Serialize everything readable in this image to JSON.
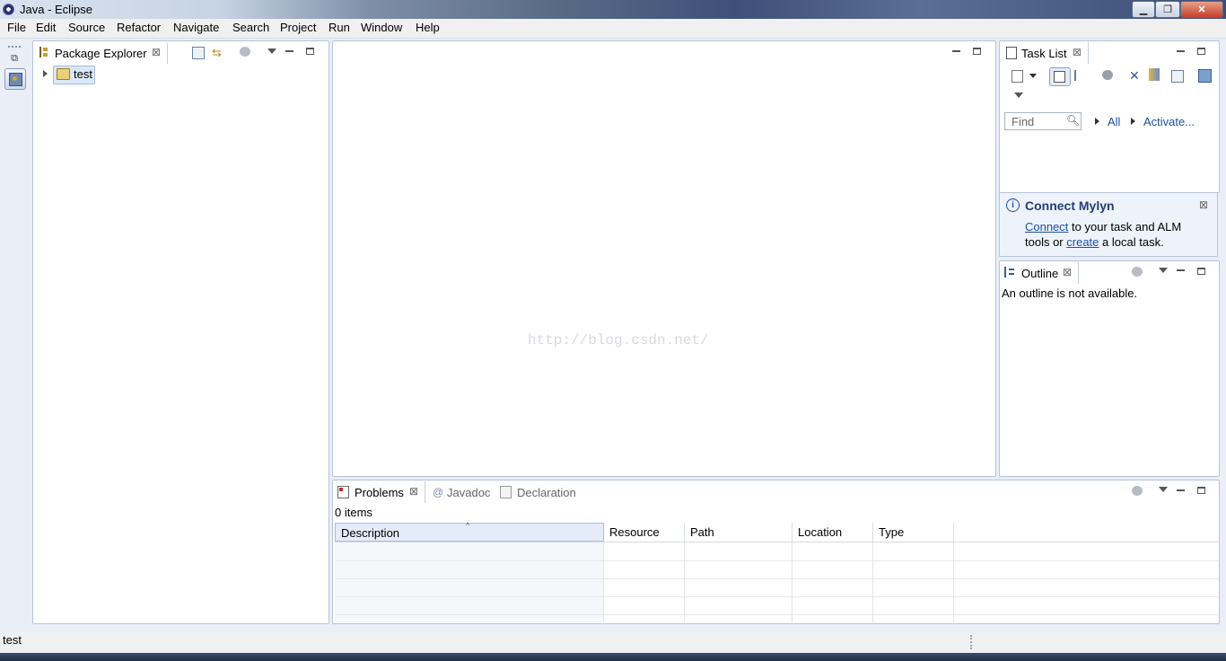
{
  "window": {
    "title": "Java - Eclipse"
  },
  "menu": [
    "File",
    "Edit",
    "Source",
    "Refactor",
    "Navigate",
    "Search",
    "Project",
    "Run",
    "Window",
    "Help"
  ],
  "package_explorer": {
    "tab_label": "Package Explorer",
    "tree": [
      {
        "label": "test"
      }
    ]
  },
  "editor": {
    "watermark": "http://blog.csdn.net/"
  },
  "task_list": {
    "tab_label": "Task List",
    "find_placeholder": "Find",
    "filter_all": "All",
    "activate": "Activate..."
  },
  "mylyn": {
    "title": "Connect Mylyn",
    "connect_link": "Connect",
    "text1": "to your task and ALM",
    "text2": "tools or",
    "create_link": "create",
    "text3": "a local task."
  },
  "outline": {
    "tab_label": "Outline",
    "message": "An outline is not available."
  },
  "problems": {
    "tabs": [
      "Problems",
      "Javadoc",
      "Declaration"
    ],
    "count": "0 items",
    "columns": [
      "Description",
      "Resource",
      "Path",
      "Location",
      "Type"
    ]
  },
  "status": {
    "text": "test"
  },
  "colors": {
    "accent": "#1d4fa3",
    "panel_border": "#b8c4d6",
    "background": "#e9eef7"
  }
}
